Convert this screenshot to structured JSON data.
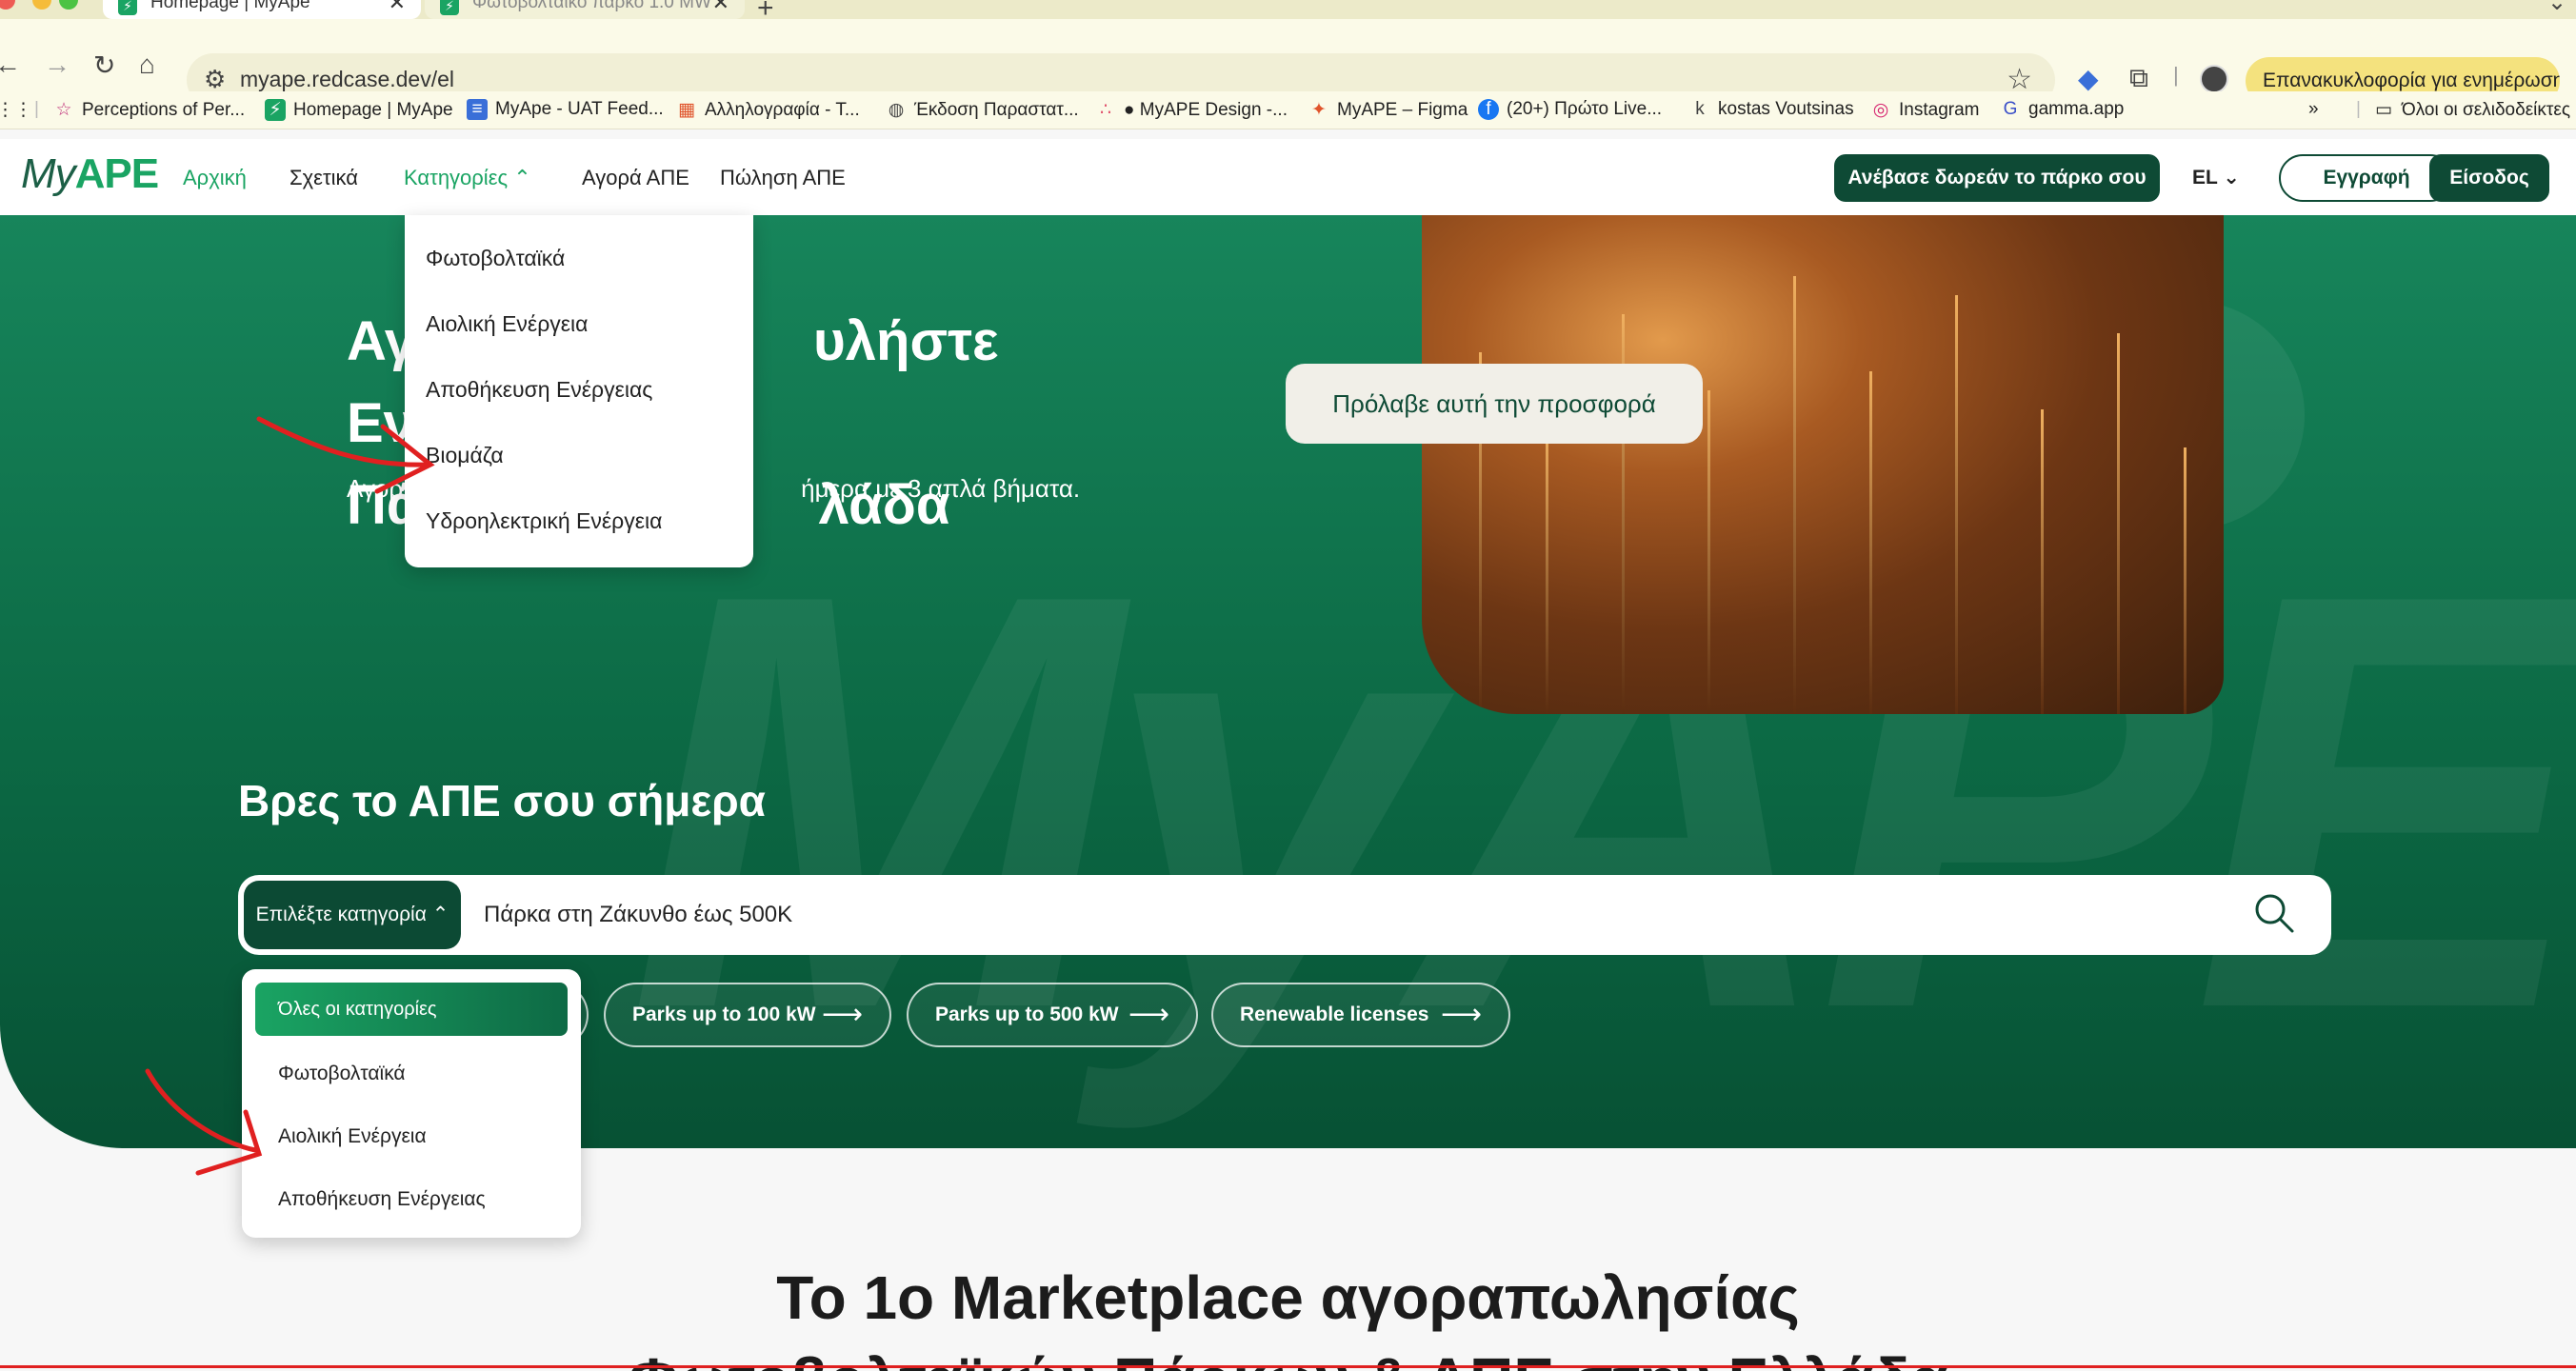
{
  "browser": {
    "tabs": [
      {
        "title": "Homepage | MyApe",
        "active": true
      },
      {
        "title": "Φωτοβολταϊκό πάρκο 1.0 MW",
        "active": false
      }
    ],
    "url": "myape.redcase.dev/el",
    "relaunch_label": "Επανακυκλοφορία για ενημέρωση",
    "bookmarks": [
      "Perceptions of Per...",
      "Homepage | MyApe",
      "MyApe - UAT Feed...",
      "Αλληλογραφία - Τ...",
      "Έκδοση Παραστατ...",
      "MyAPE Design -...",
      "MyAPE – Figma",
      "(20+) Πρώτο Live...",
      "kostas Voutsinas",
      "Instagram",
      "gamma.app"
    ],
    "all_bookmarks_label": "Όλοι οι σελιδοδείκτες"
  },
  "site": {
    "logo_my": "My",
    "logo_ape": "APE",
    "nav": {
      "home": "Αρχική",
      "about": "Σχετικά",
      "categories": "Κατηγορίες",
      "buy": "Αγορά ΑΠΕ",
      "sell": "Πώληση ΑΠΕ"
    },
    "upload_button": "Ανέβασε δωρεάν το πάρκο σου",
    "lang": "EL",
    "register": "Εγγραφή",
    "login": "Είσοδος"
  },
  "categories_menu": [
    "Φωτοβολταϊκά",
    "Αιολική Ενέργεια",
    "Αποθήκευση Ενέργειας",
    "Βιομάζα",
    "Υδροηλεκτρική Ενέργεια"
  ],
  "hero": {
    "title_line1": "Αγ",
    "title_line1_end": "υλήστε Ενεργειακά",
    "title_line2": "Πά",
    "title_line2_end": "λάδα",
    "subtitle_start": "Αγορ",
    "subtitle_end": "ήμερα με 3 απλά βήματα.",
    "offer_button": "Πρόλαβε αυτή την προσφορά",
    "watermark": "MyAPE"
  },
  "search": {
    "heading": "Βρες το ΑΠΕ σου σήμερα",
    "category_select": "Επιλέξτε κατηγορία",
    "query": "Πάρκα στη Ζάκυνθο έως 500Κ",
    "chips": [
      "Parks up to 100 kW",
      "Parks up to 500 kW",
      "Renewable licenses"
    ]
  },
  "search_category_menu": {
    "selected": "Όλες οι κατηγορίες",
    "items": [
      "Φωτοβολταϊκά",
      "Αιολική Ενέργεια",
      "Αποθήκευση Ενέργειας"
    ]
  },
  "bottom": {
    "title_line1": "Το 1ο Marketplace αγοραπωλησίας",
    "title_line2": "Φωτοβολταϊκών Πάρκων & ΑΠΕ στην Ελλάδα"
  },
  "colors": {
    "brand_green": "#1aa463",
    "brand_dark": "#0e4a35",
    "annotation_red": "#e02020"
  }
}
